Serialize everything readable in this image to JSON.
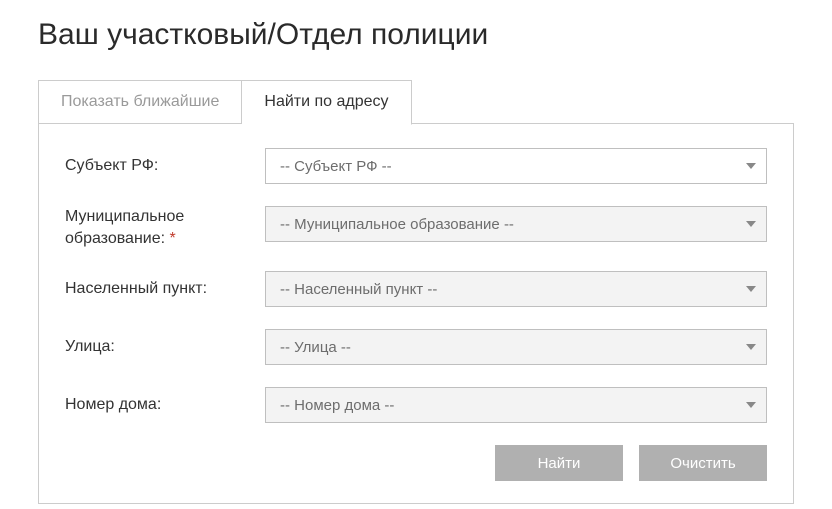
{
  "title": "Ваш участковый/Отдел полиции",
  "tabs": {
    "nearest": "Показать ближайшие",
    "by_address": "Найти по адресу"
  },
  "form": {
    "subject": {
      "label": "Субъект РФ:",
      "value": "-- Субъект РФ --"
    },
    "municipality": {
      "label": "Муниципальное образование:",
      "required": "*",
      "value": "-- Муниципальное образование --"
    },
    "locality": {
      "label": "Населенный пункт:",
      "value": "-- Населенный пункт --"
    },
    "street": {
      "label": "Улица:",
      "value": "-- Улица --"
    },
    "house": {
      "label": "Номер дома:",
      "value": "-- Номер дома --"
    }
  },
  "actions": {
    "submit": "Найти",
    "reset": "Очистить"
  }
}
